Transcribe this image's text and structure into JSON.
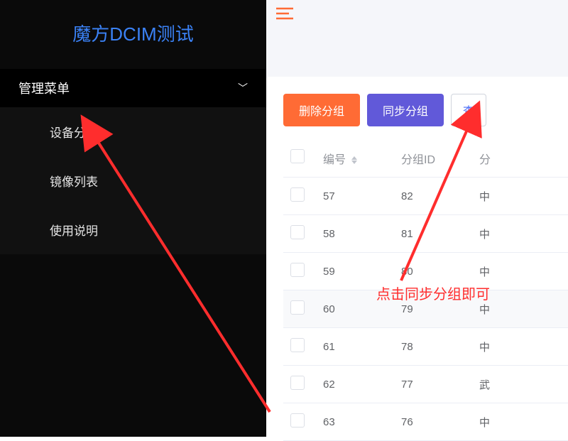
{
  "sidebar": {
    "title": "魔方DCIM测试",
    "menu_header": "管理菜单",
    "items": [
      {
        "label": "设备分组"
      },
      {
        "label": "镜像列表"
      },
      {
        "label": "使用说明"
      }
    ]
  },
  "toolbar": {
    "delete_group": "删除分组",
    "sync_group": "同步分组",
    "query": "查"
  },
  "table": {
    "headers": {
      "id": "编号",
      "group_id": "分组ID",
      "name": "分"
    },
    "rows": [
      {
        "id": "57",
        "group_id": "82",
        "name": "中"
      },
      {
        "id": "58",
        "group_id": "81",
        "name": "中"
      },
      {
        "id": "59",
        "group_id": "80",
        "name": "中"
      },
      {
        "id": "60",
        "group_id": "79",
        "name": "中"
      },
      {
        "id": "61",
        "group_id": "78",
        "name": "中"
      },
      {
        "id": "62",
        "group_id": "77",
        "name": "武"
      },
      {
        "id": "63",
        "group_id": "76",
        "name": "中"
      }
    ]
  },
  "annotation": {
    "text": "点击同步分组即可"
  }
}
